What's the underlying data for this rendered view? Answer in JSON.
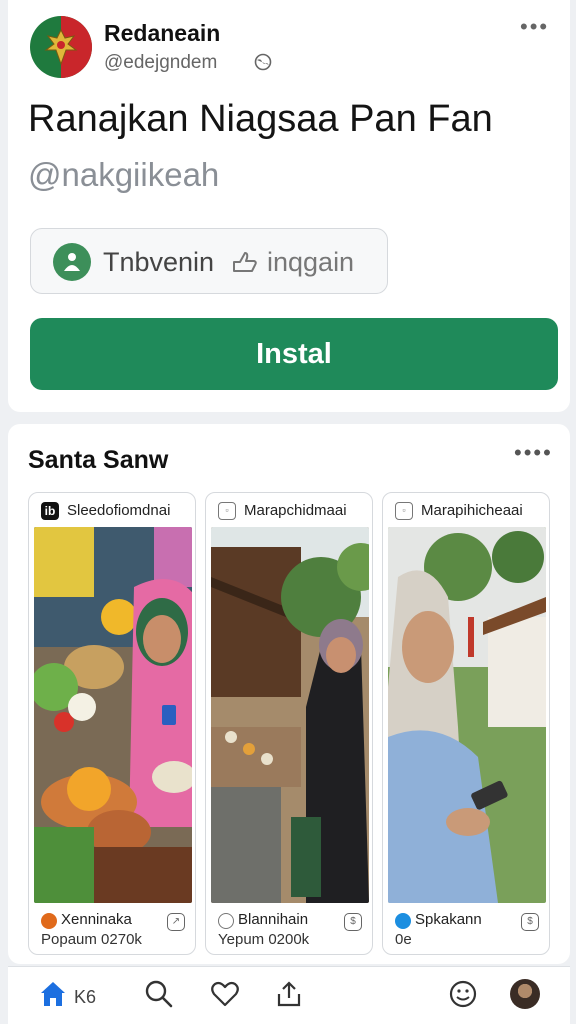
{
  "account": {
    "name": "Redaneain",
    "handle": "@edejgndem"
  },
  "post": {
    "title": "Ranajkan Niagsaa Pan Fan",
    "handle": "@nakgiikeah",
    "chip_label": "Tnbvenin",
    "chip_label2": "inqgain",
    "install_label": "Instal"
  },
  "section": {
    "title": "Santa Sanw",
    "tiles": [
      {
        "head_label": "Sleedofiomdnai",
        "head_icon": "ib",
        "foot_title": "Xenninaka",
        "foot_sub": "Popaum 0270k",
        "foot_color": "#e06a1b"
      },
      {
        "head_label": "Marapchidmaai",
        "head_icon": "",
        "foot_title": "Blannihain",
        "foot_sub": "Yepum 0200k",
        "foot_color": "#777777"
      },
      {
        "head_label": "Marapihicheaai",
        "head_icon": "",
        "foot_title": "Spkakann",
        "foot_sub": "0e",
        "foot_color": "#1c8ee0"
      }
    ]
  },
  "nav": {
    "home_label": "K6"
  },
  "colors": {
    "install": "#1f8a5a",
    "chip_icon": "#3d8f5a",
    "nav_home": "#1c6fe0"
  },
  "icons": [
    "globe-icon",
    "more-icon",
    "person-icon",
    "hand-icon",
    "home-icon",
    "search-icon",
    "heart-icon",
    "share-icon",
    "emoji-icon"
  ]
}
